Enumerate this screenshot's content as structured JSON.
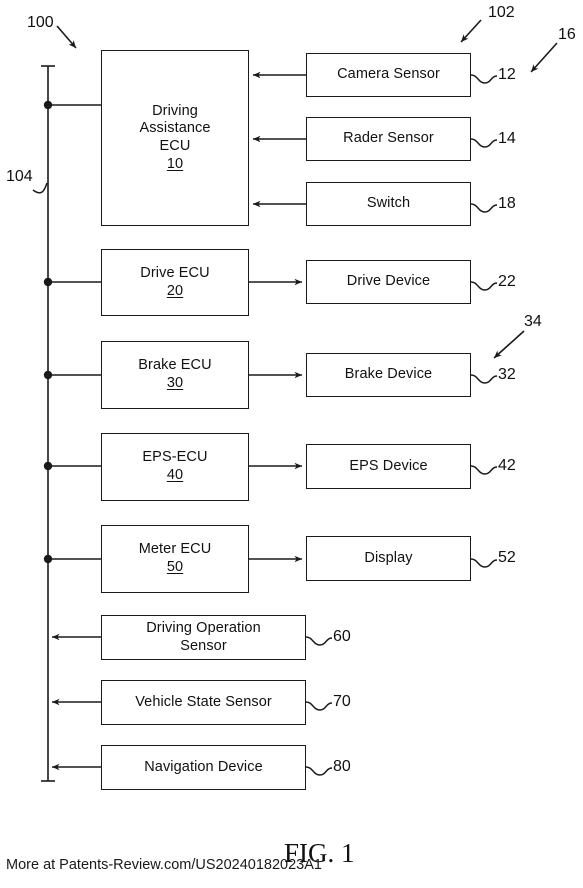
{
  "figure": {
    "caption": "FIG. 1",
    "footer": "More at Patents-Review.com/US20240182023A1",
    "system_ref": "100",
    "bus_ref": "104",
    "sensor_group_ref": "102",
    "sensor_group_ref_2": "16",
    "actuator_group_ref": "34"
  },
  "blocks": {
    "driving_assistance_ecu": {
      "line1": "Driving",
      "line2": "Assistance",
      "line3": "ECU",
      "ref": "10"
    },
    "camera_sensor": {
      "label": "Camera Sensor",
      "ref": "12"
    },
    "rader_sensor": {
      "label": "Rader Sensor",
      "ref": "14"
    },
    "switch": {
      "label": "Switch",
      "ref": "18"
    },
    "drive_ecu": {
      "label": "Drive ECU",
      "ref": "20"
    },
    "drive_device": {
      "label": "Drive Device",
      "ref": "22"
    },
    "brake_ecu": {
      "label": "Brake ECU",
      "ref": "30"
    },
    "brake_device": {
      "label": "Brake Device",
      "ref": "32"
    },
    "eps_ecu": {
      "label": "EPS-ECU",
      "ref": "40"
    },
    "eps_device": {
      "label": "EPS Device",
      "ref": "42"
    },
    "meter_ecu": {
      "label": "Meter ECU",
      "ref": "50"
    },
    "display": {
      "label": "Display",
      "ref": "52"
    },
    "driving_operation_sensor": {
      "line1": "Driving Operation",
      "line2": "Sensor",
      "ref": "60"
    },
    "vehicle_state_sensor": {
      "label": "Vehicle State Sensor",
      "ref": "70"
    },
    "navigation_device": {
      "label": "Navigation Device",
      "ref": "80"
    }
  }
}
